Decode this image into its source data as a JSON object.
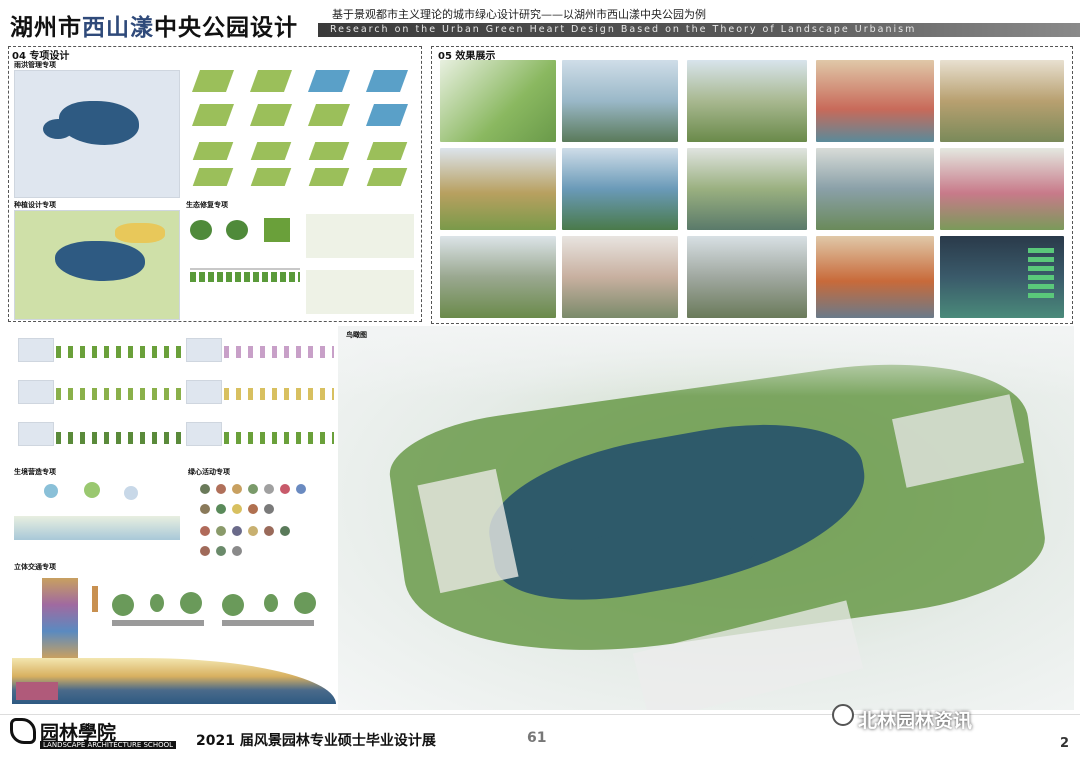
{
  "header": {
    "title_part1": "湖州市",
    "title_part2": "西山漾",
    "title_part3": "中央公园设计",
    "subtitle_cn": "基于景观都市主义理论的城市绿心设计研究——以湖州市西山漾中央公园为例",
    "subtitle_en": "Research on the Urban Green Heart Design Based on the Theory of Landscape Urbanism"
  },
  "section04": {
    "title": "04 专项设计",
    "stormwater": "雨洪管理专项",
    "planting": "种植设计专项",
    "ecology": "生态修复专项",
    "habitat": "生境营造专项",
    "activity": "绿心活动专项",
    "traffic": "立体交通专项"
  },
  "section05": {
    "title": "05 效果展示",
    "aerial": "鸟瞰图"
  },
  "footer": {
    "school": "园林學院",
    "school_en": "LANDSCAPE ARCHITECTURE SCHOOL",
    "exhibition": "2021 届风景园林专业硕士毕业设计展",
    "page": "61",
    "corner": "2",
    "wechat": "北林园林资讯"
  },
  "colors": {
    "title_accent": "#2f4a7a",
    "lake": "#2e5a82",
    "vegetation": "#9bbf5a",
    "band": "#4a4a4a"
  }
}
